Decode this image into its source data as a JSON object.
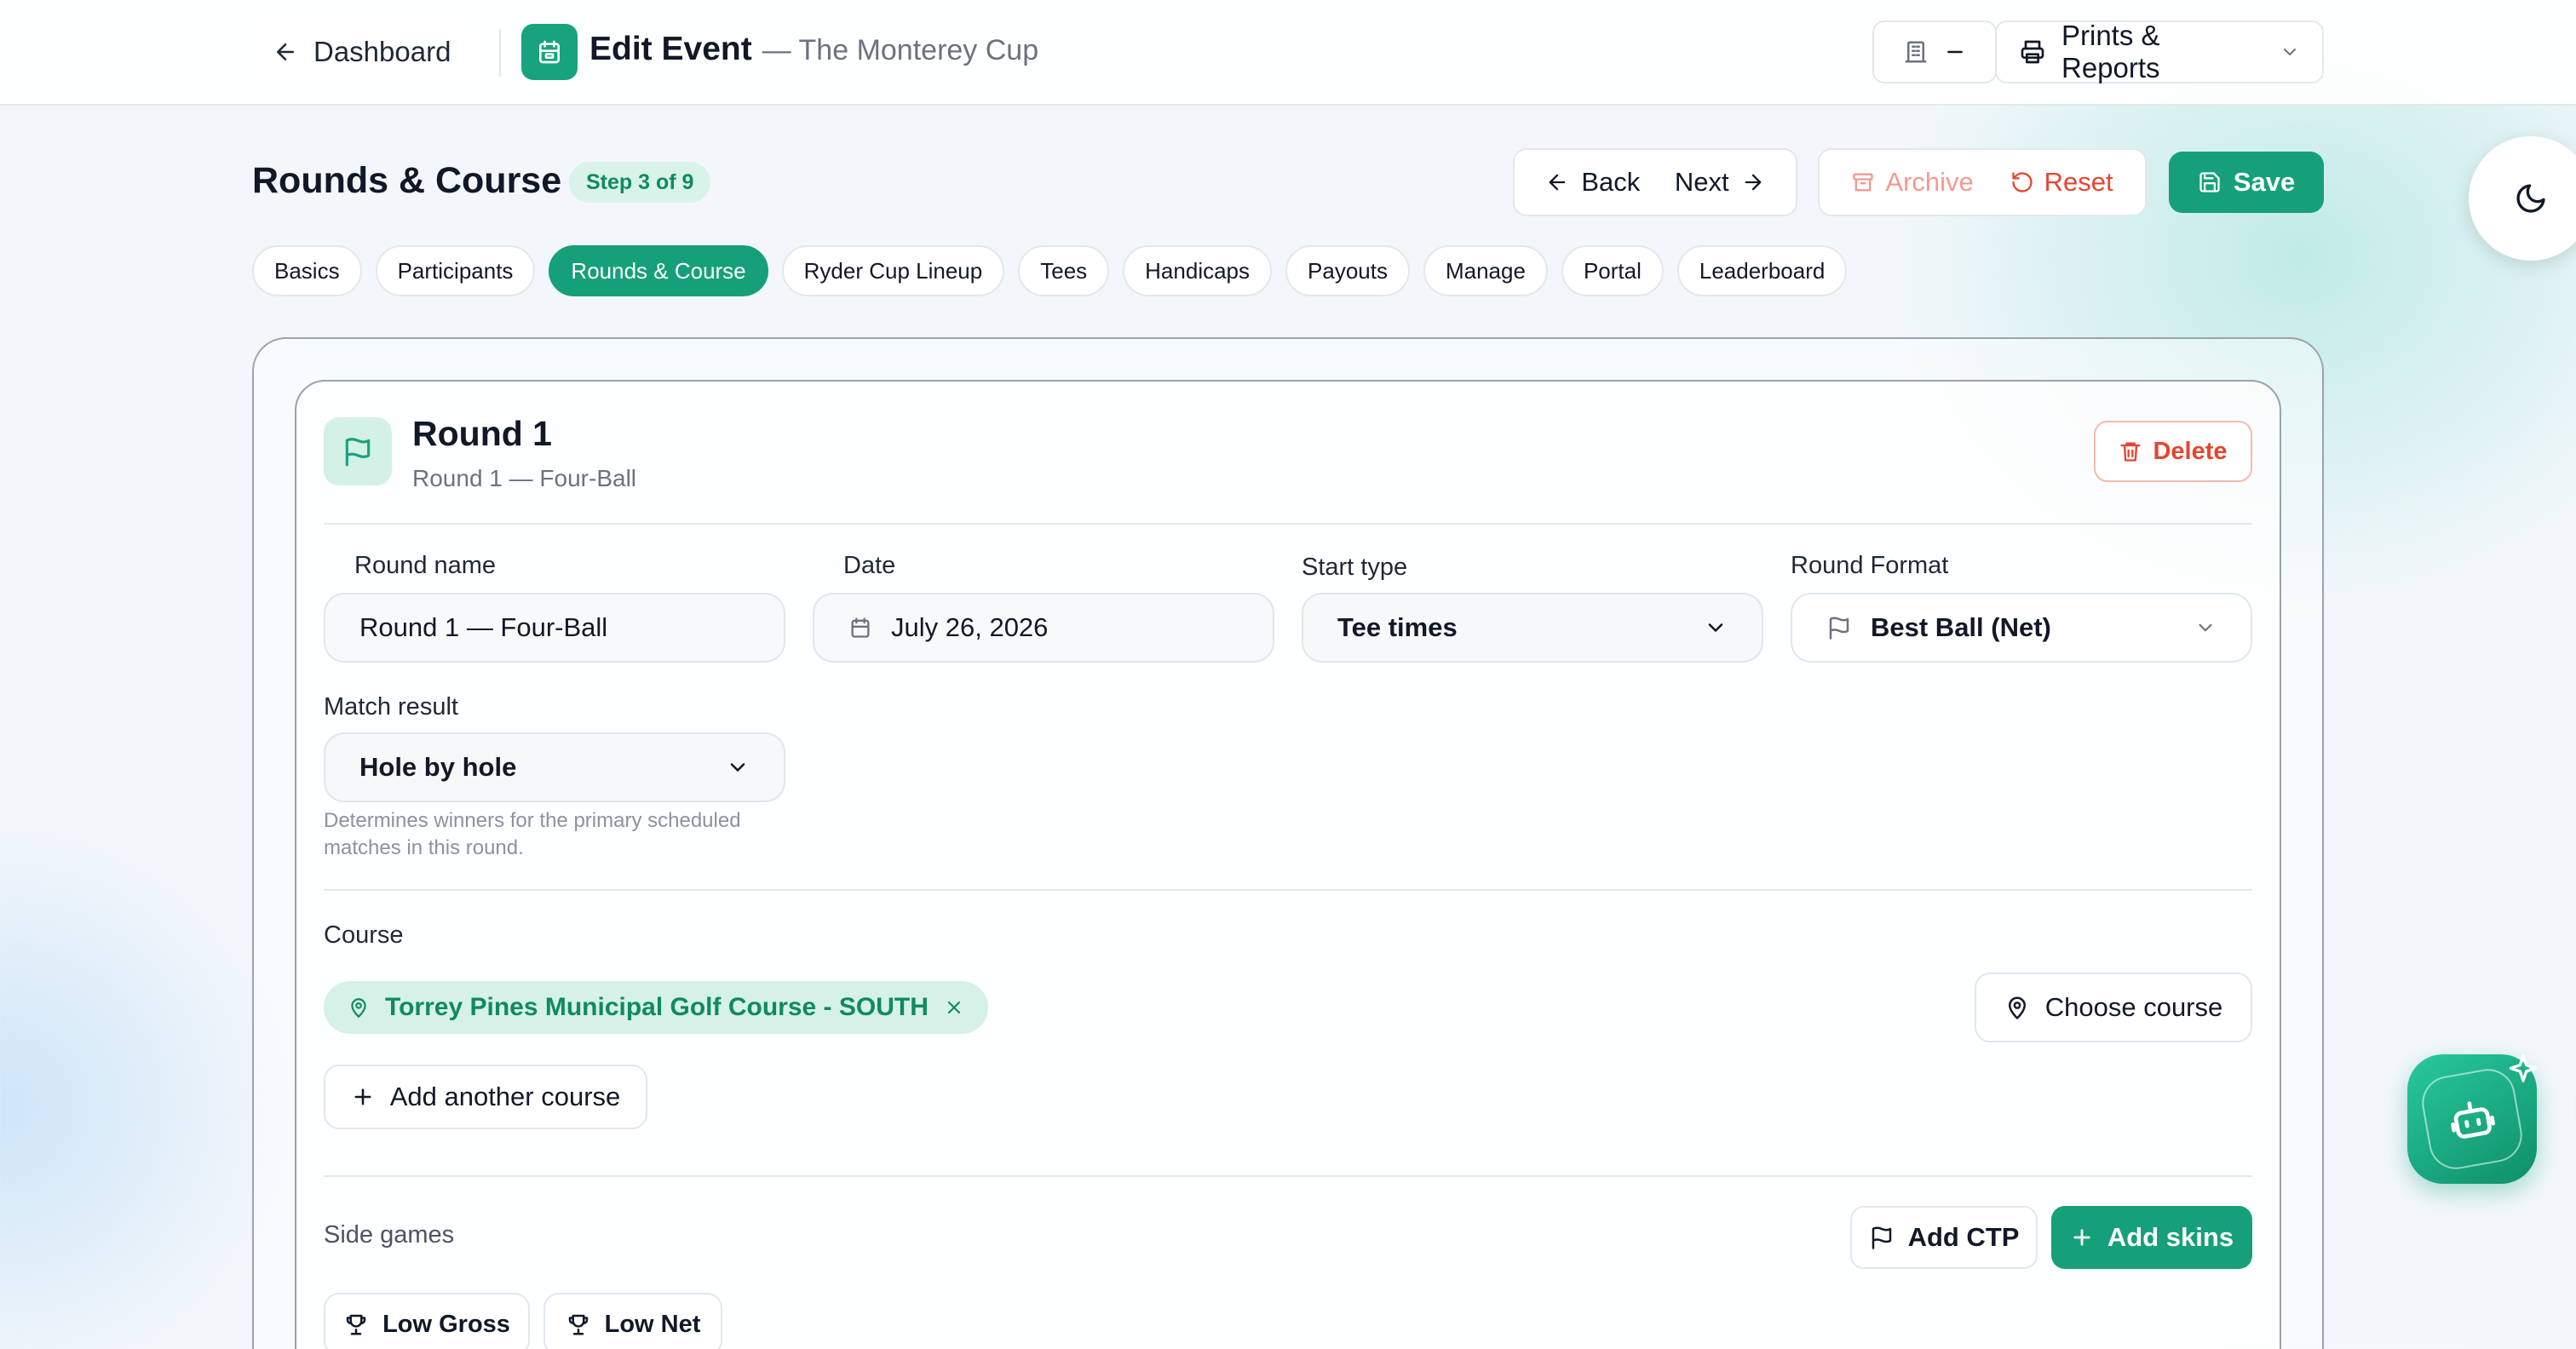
{
  "topbar": {
    "dashboard_label": "Dashboard",
    "edit_title": "Edit Event",
    "event_name": "— The Monterey Cup",
    "prints_label": "Prints & Reports"
  },
  "header": {
    "page_title": "Rounds & Course",
    "step_badge": "Step 3 of 9",
    "back_label": "Back",
    "next_label": "Next",
    "archive_label": "Archive",
    "reset_label": "Reset",
    "save_label": "Save"
  },
  "tabs": [
    {
      "label": "Basics"
    },
    {
      "label": "Participants"
    },
    {
      "label": "Rounds & Course",
      "active": true
    },
    {
      "label": "Ryder Cup Lineup"
    },
    {
      "label": "Tees"
    },
    {
      "label": "Handicaps"
    },
    {
      "label": "Payouts"
    },
    {
      "label": "Manage"
    },
    {
      "label": "Portal"
    },
    {
      "label": "Leaderboard"
    }
  ],
  "round": {
    "title": "Round 1",
    "subtitle": "Round 1 — Four-Ball",
    "delete_label": "Delete",
    "round_name_label": "Round name",
    "round_name_value": "Round 1 — Four-Ball",
    "date_label": "Date",
    "date_value": "July 26, 2026",
    "start_type_label": "Start type",
    "start_type_value": "Tee times",
    "round_format_label": "Round Format",
    "round_format_value": "Best Ball (Net)",
    "match_result_label": "Match result",
    "match_result_value": "Hole by hole",
    "match_result_hint": "Determines winners for the primary scheduled matches in this round.",
    "course_label": "Course",
    "course_chip": "Torrey Pines Municipal Golf Course - SOUTH",
    "choose_course_label": "Choose course",
    "add_course_label": "Add another course",
    "side_games_label": "Side games",
    "add_ctp_label": "Add CTP",
    "add_skins_label": "Add skins",
    "side_games": [
      {
        "label": "Low Gross"
      },
      {
        "label": "Low Net"
      }
    ]
  },
  "colors": {
    "accent": "#15a079",
    "danger": "#e5452f",
    "chip_bg": "#d6f1e8"
  },
  "icons": {
    "back": "arrow-left-icon",
    "calendar": "calendar-icon",
    "printer": "printer-icon",
    "flag": "flag-icon",
    "trash": "trash-icon",
    "map_pin": "map-pin-icon",
    "trophy": "trophy-icon",
    "moon": "moon-icon",
    "robot": "robot-icon"
  }
}
